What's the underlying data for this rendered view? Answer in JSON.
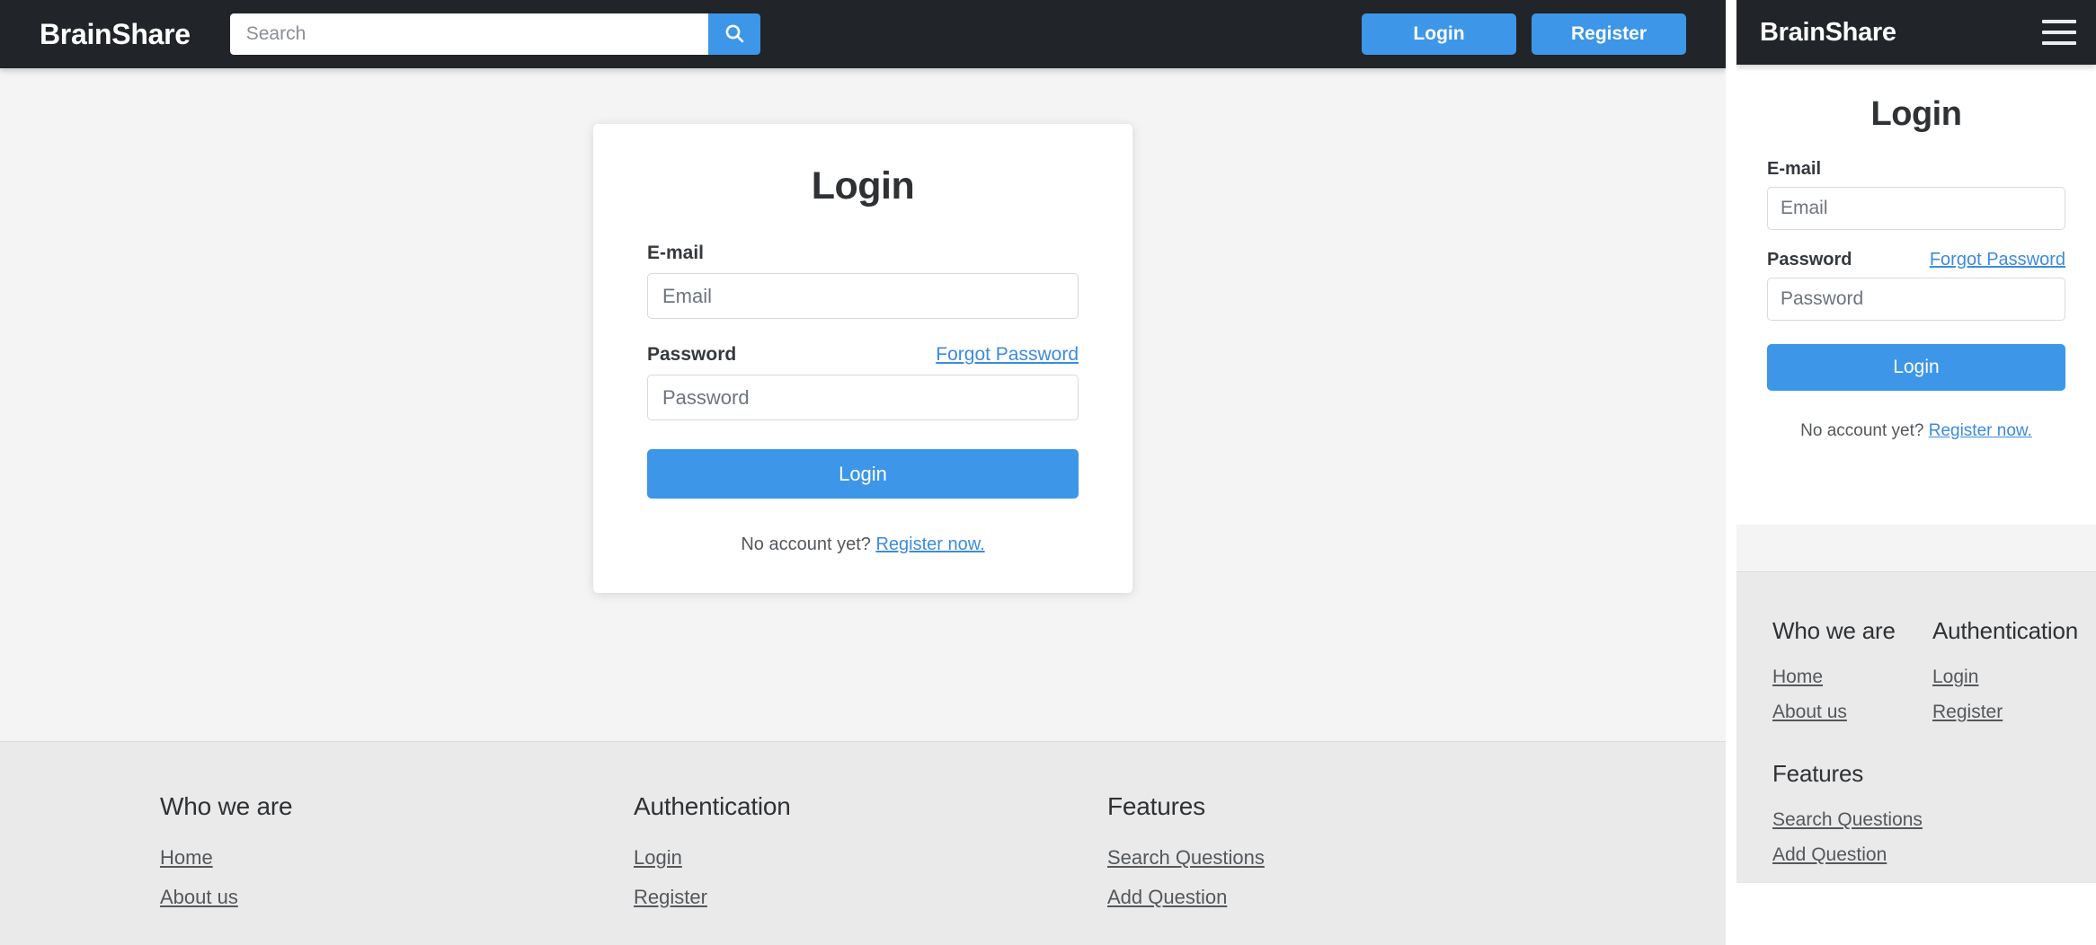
{
  "brand": "BrainShare",
  "theme": {
    "navbar_bg": "#212529",
    "accent": "#3d96e8",
    "link": "#3d8bdd",
    "page_bg": "#f4f4f5",
    "footer_bg": "#eaeaea",
    "card_bg": "#ffffff"
  },
  "desktop": {
    "navbar": {
      "brand": "BrainShare",
      "search_placeholder": "Search",
      "search_value": "",
      "search_icon": "search-icon",
      "login_label": "Login",
      "register_label": "Register"
    },
    "login_card": {
      "title": "Login",
      "email_label": "E-mail",
      "email_placeholder": "Email",
      "email_value": "",
      "password_label": "Password",
      "password_placeholder": "Password",
      "password_value": "",
      "forgot_label": "Forgot Password",
      "submit_label": "Login",
      "signup_prompt": "No account yet?",
      "signup_link": "Register now."
    },
    "footer": {
      "columns": [
        {
          "heading": "Who we are",
          "links": [
            "Home",
            "About us"
          ]
        },
        {
          "heading": "Authentication",
          "links": [
            "Login",
            "Register"
          ]
        },
        {
          "heading": "Features",
          "links": [
            "Search Questions",
            "Add Question"
          ]
        }
      ]
    }
  },
  "mobile": {
    "navbar": {
      "brand": "BrainShare",
      "menu_icon": "hamburger-menu-icon"
    },
    "login_card": {
      "title": "Login",
      "email_label": "E-mail",
      "email_placeholder": "Email",
      "email_value": "",
      "password_label": "Password",
      "password_placeholder": "Password",
      "password_value": "",
      "forgot_label": "Forgot Password",
      "submit_label": "Login",
      "signup_prompt": "No account yet?",
      "signup_link": "Register now."
    },
    "footer": {
      "columns": [
        {
          "heading": "Who we are",
          "links": [
            "Home",
            "About us"
          ]
        },
        {
          "heading": "Authentication",
          "links": [
            "Login",
            "Register"
          ]
        },
        {
          "heading": "Features",
          "links": [
            "Search Questions",
            "Add Question"
          ]
        }
      ]
    }
  }
}
